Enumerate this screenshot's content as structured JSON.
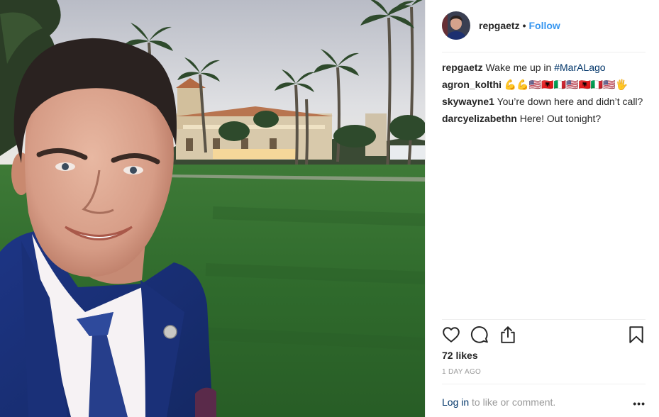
{
  "post": {
    "username": "repgaetz",
    "separator": "•",
    "follow_label": "Follow",
    "caption_user": "repgaetz",
    "caption_text": " Wake me up in ",
    "caption_hashtag": "#MarALago"
  },
  "comments": [
    {
      "user": "agron_kolthi",
      "text": "💪💪🇺🇸🇦🇱🇮🇹🇺🇸🇦🇱🇮🇹🇺🇸🖐"
    },
    {
      "user": "skywayne1",
      "text": " You’re down here and didn’t call?"
    },
    {
      "user": "darcyelizabethn",
      "text": " Here! Out tonight?"
    }
  ],
  "icons": {
    "like": "heart-icon",
    "comment": "comment-icon",
    "share": "share-icon",
    "save": "bookmark-icon",
    "more": "more-options-icon"
  },
  "likes_label": "72 likes",
  "time_ago": "1 DAY AGO",
  "footer": {
    "login_label": "Log in",
    "rest": " to like or comment.",
    "more_label": "•••"
  },
  "colors": {
    "link_blue": "#3897f0",
    "hashtag": "#003569",
    "muted": "#999999",
    "text": "#262626"
  }
}
